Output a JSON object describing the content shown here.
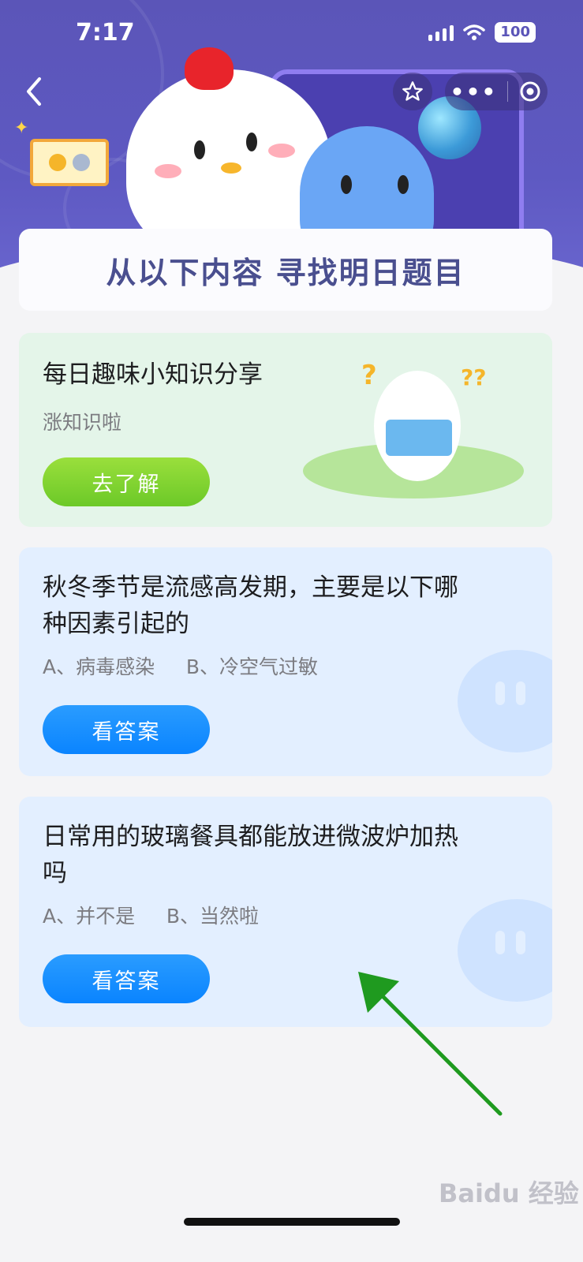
{
  "status_bar": {
    "time": "7:17",
    "battery": "100"
  },
  "header": {
    "title": "从以下内容 寻找明日题目"
  },
  "trivia_card": {
    "title": "每日趣味小知识分享",
    "subtitle": "涨知识啦",
    "button_label": "去了解"
  },
  "questions": [
    {
      "question": "秋冬季节是流感高发期，主要是以下哪种因素引起的",
      "line1": "秋冬季节是流感高发期，主要是以下哪",
      "line2": "种因素引起的",
      "options": "A、病毒感染     B、冷空气过敏",
      "button_label": "看答案"
    },
    {
      "question": "日常用的玻璃餐具都能放进微波炉加热吗",
      "line1": "日常用的玻璃餐具都能放进微波炉加热",
      "line2": "吗",
      "options": "A、并不是     B、当然啦",
      "button_label": "看答案"
    }
  ],
  "watermark": "Baidu 经验",
  "colors": {
    "banner": "#5b55b8",
    "green_button": "#6cc928",
    "blue_button": "#0a84ff",
    "arrow": "#1f9a1f"
  }
}
